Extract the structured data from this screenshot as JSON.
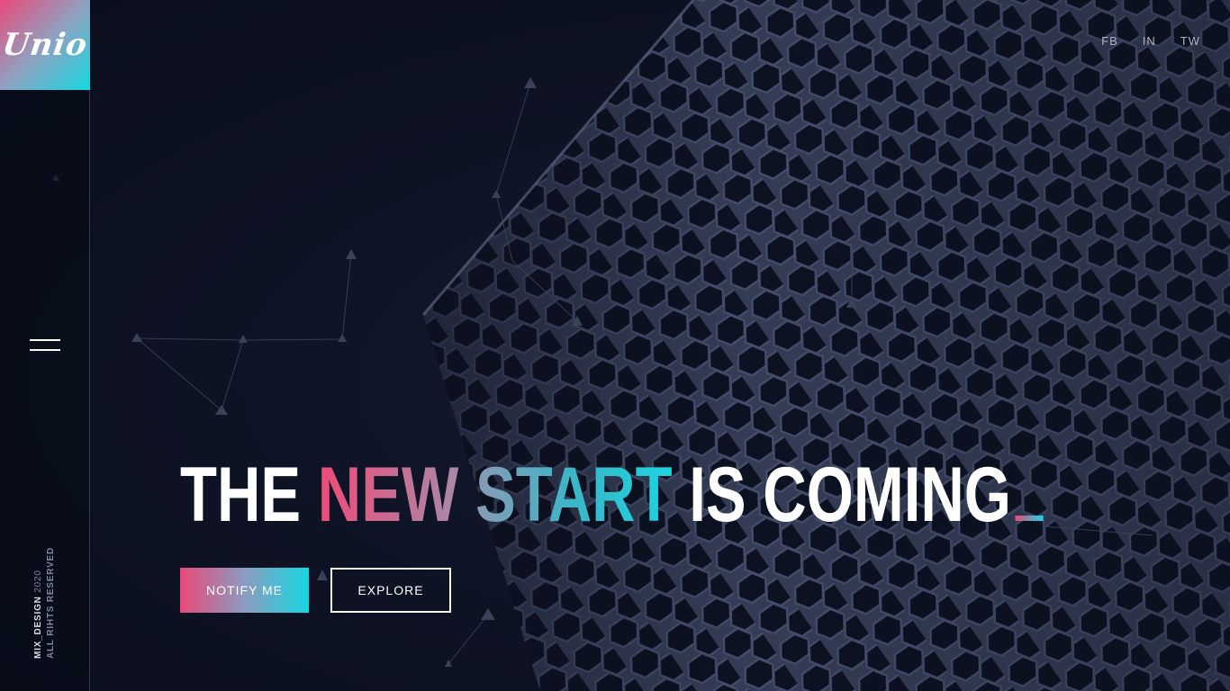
{
  "brand": {
    "logo_text": "Unio"
  },
  "sidebar": {
    "menu_icon": "hamburger-menu-icon",
    "copyright_brand": "MIX_DESIGN",
    "copyright_year": "2020",
    "copyright_reserved": "ALL RIHTS RESERVED"
  },
  "social": {
    "links": [
      "FB",
      "IN",
      "TW"
    ]
  },
  "hero": {
    "word_1": "THE",
    "word_2": "NEW",
    "word_3": "START",
    "word_4": "IS COMING"
  },
  "actions": {
    "notify_label": "NOTIFY ME",
    "explore_label": "EXPLORE"
  },
  "colors": {
    "background": "#0a0e1c",
    "accent_pink": "#e94a7a",
    "accent_cyan": "#14d8e2",
    "text": "#ffffff"
  }
}
